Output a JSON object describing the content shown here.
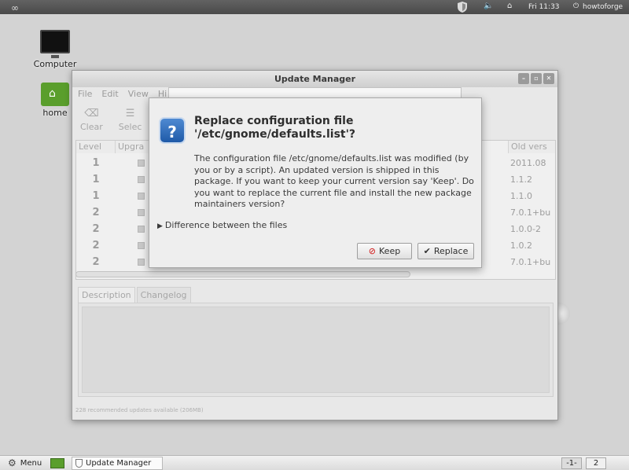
{
  "top_panel": {
    "logo_icon": "infinity-logo",
    "clock": "Fri 11:33",
    "username": "howtoforge"
  },
  "desktop": {
    "icons": [
      {
        "label": "Computer",
        "icon": "monitor-icon"
      },
      {
        "label": "home",
        "icon": "home-folder-icon"
      }
    ]
  },
  "update_manager": {
    "title": "Update Manager",
    "menu": [
      "File",
      "Edit",
      "View",
      "Hi"
    ],
    "toolbar": [
      {
        "label": "Clear",
        "icon": "clear-icon"
      },
      {
        "label": "Selec",
        "icon": "select-icon"
      }
    ],
    "columns": [
      "Level",
      "Upgra",
      "Old vers"
    ],
    "rows": [
      {
        "level": "1",
        "old_version": "2011.08"
      },
      {
        "level": "1",
        "old_version": "1.1.2"
      },
      {
        "level": "1",
        "old_version": "1.1.0"
      },
      {
        "level": "2",
        "old_version": "7.0.1+bu"
      },
      {
        "level": "2",
        "old_version": "1.0.0-2"
      },
      {
        "level": "2",
        "old_version": "1.0.2"
      },
      {
        "level": "2",
        "old_version": "7.0.1+bu"
      }
    ],
    "tabs": [
      "Description",
      "Changelog"
    ],
    "status": "228 recommended updates available (206MB)"
  },
  "dialog": {
    "title": "Replace configuration file '/etc/gnome/defaults.list'?",
    "body": "The configuration file /etc/gnome/defaults.list was modified (by you or by a script). An updated version is shipped in this package. If you want to keep your current version say 'Keep'. Do you want to replace the current file and install the new package maintainers version?",
    "expander": "Difference between the files",
    "keep_label": "Keep",
    "replace_label": "Replace"
  },
  "bottom_panel": {
    "menu_label": "Menu",
    "task": "Update Manager",
    "workspaces": [
      "-1-",
      "2"
    ]
  }
}
